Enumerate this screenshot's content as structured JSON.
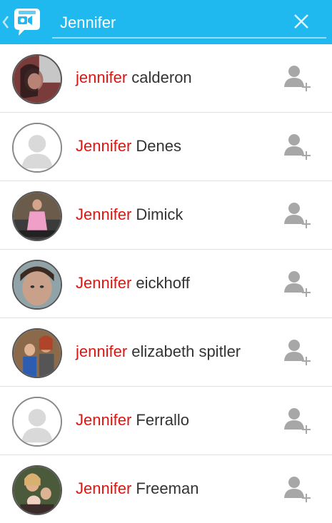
{
  "search": {
    "value": "Jennifer",
    "highlight_color": "#e3130f",
    "accent_color": "#1fb9f0"
  },
  "icons": {
    "back": "chevron-left-icon",
    "logo": "video-chat-logo-icon",
    "clear": "close-icon",
    "add": "add-friend-icon"
  },
  "results": [
    {
      "match": "jennifer",
      "rest": " calderon",
      "avatar": "photo"
    },
    {
      "match": "Jennifer",
      "rest": " Denes",
      "avatar": "placeholder"
    },
    {
      "match": "Jennifer",
      "rest": " Dimick",
      "avatar": "photo"
    },
    {
      "match": "Jennifer",
      "rest": " eickhoff",
      "avatar": "photo"
    },
    {
      "match": "jennifer",
      "rest": " elizabeth spitler",
      "avatar": "photo"
    },
    {
      "match": "Jennifer",
      "rest": " Ferrallo",
      "avatar": "placeholder"
    },
    {
      "match": "Jennifer",
      "rest": " Freeman",
      "avatar": "photo"
    }
  ]
}
